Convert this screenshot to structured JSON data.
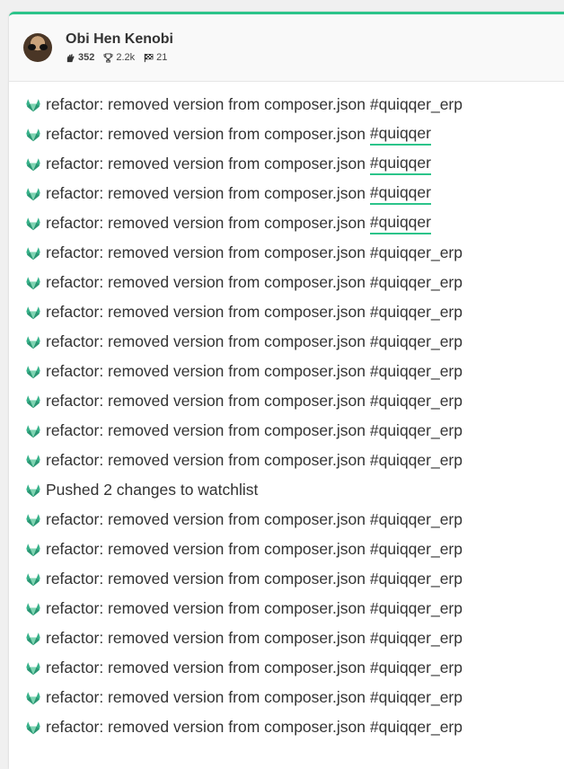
{
  "user": {
    "name": "Obi Hen Kenobi",
    "stats": {
      "points": "352",
      "trophies": "2.2k",
      "finishes": "21"
    }
  },
  "feed": [
    {
      "text": "refactor: removed version from composer.json",
      "tag": "#quiqqer_erp",
      "linked": false
    },
    {
      "text": "refactor: removed version from composer.json",
      "tag": "#quiqqer",
      "linked": true
    },
    {
      "text": "refactor: removed version from composer.json",
      "tag": "#quiqqer",
      "linked": true
    },
    {
      "text": "refactor: removed version from composer.json",
      "tag": "#quiqqer",
      "linked": true
    },
    {
      "text": "refactor: removed version from composer.json",
      "tag": "#quiqqer",
      "linked": true
    },
    {
      "text": "refactor: removed version from composer.json",
      "tag": "#quiqqer_erp",
      "linked": false
    },
    {
      "text": "refactor: removed version from composer.json",
      "tag": "#quiqqer_erp",
      "linked": false
    },
    {
      "text": "refactor: removed version from composer.json",
      "tag": "#quiqqer_erp",
      "linked": false
    },
    {
      "text": "refactor: removed version from composer.json",
      "tag": "#quiqqer_erp",
      "linked": false
    },
    {
      "text": "refactor: removed version from composer.json",
      "tag": "#quiqqer_erp",
      "linked": false
    },
    {
      "text": "refactor: removed version from composer.json",
      "tag": "#quiqqer_erp",
      "linked": false
    },
    {
      "text": "refactor: removed version from composer.json",
      "tag": "#quiqqer_erp",
      "linked": false
    },
    {
      "text": "refactor: removed version from composer.json",
      "tag": "#quiqqer_erp",
      "linked": false
    },
    {
      "text": "Pushed 2 changes to watchlist",
      "tag": "",
      "linked": false
    },
    {
      "text": "refactor: removed version from composer.json",
      "tag": "#quiqqer_erp",
      "linked": false
    },
    {
      "text": "refactor: removed version from composer.json",
      "tag": "#quiqqer_erp",
      "linked": false
    },
    {
      "text": "refactor: removed version from composer.json",
      "tag": "#quiqqer_erp",
      "linked": false
    },
    {
      "text": "refactor: removed version from composer.json",
      "tag": "#quiqqer_erp",
      "linked": false
    },
    {
      "text": "refactor: removed version from composer.json",
      "tag": "#quiqqer_erp",
      "linked": false
    },
    {
      "text": "refactor: removed version from composer.json",
      "tag": "#quiqqer_erp",
      "linked": false
    },
    {
      "text": "refactor: removed version from composer.json",
      "tag": "#quiqqer_erp",
      "linked": false
    },
    {
      "text": "refactor: removed version from composer.json",
      "tag": "#quiqqer_erp",
      "linked": false
    }
  ],
  "colors": {
    "accent": "#2bc48a",
    "icon": "#38b28a"
  },
  "icons": {
    "feed_item": "gitlab-fox-icon",
    "points": "hand-icon",
    "trophies": "trophy-icon",
    "finishes": "checkered-flag-icon"
  }
}
